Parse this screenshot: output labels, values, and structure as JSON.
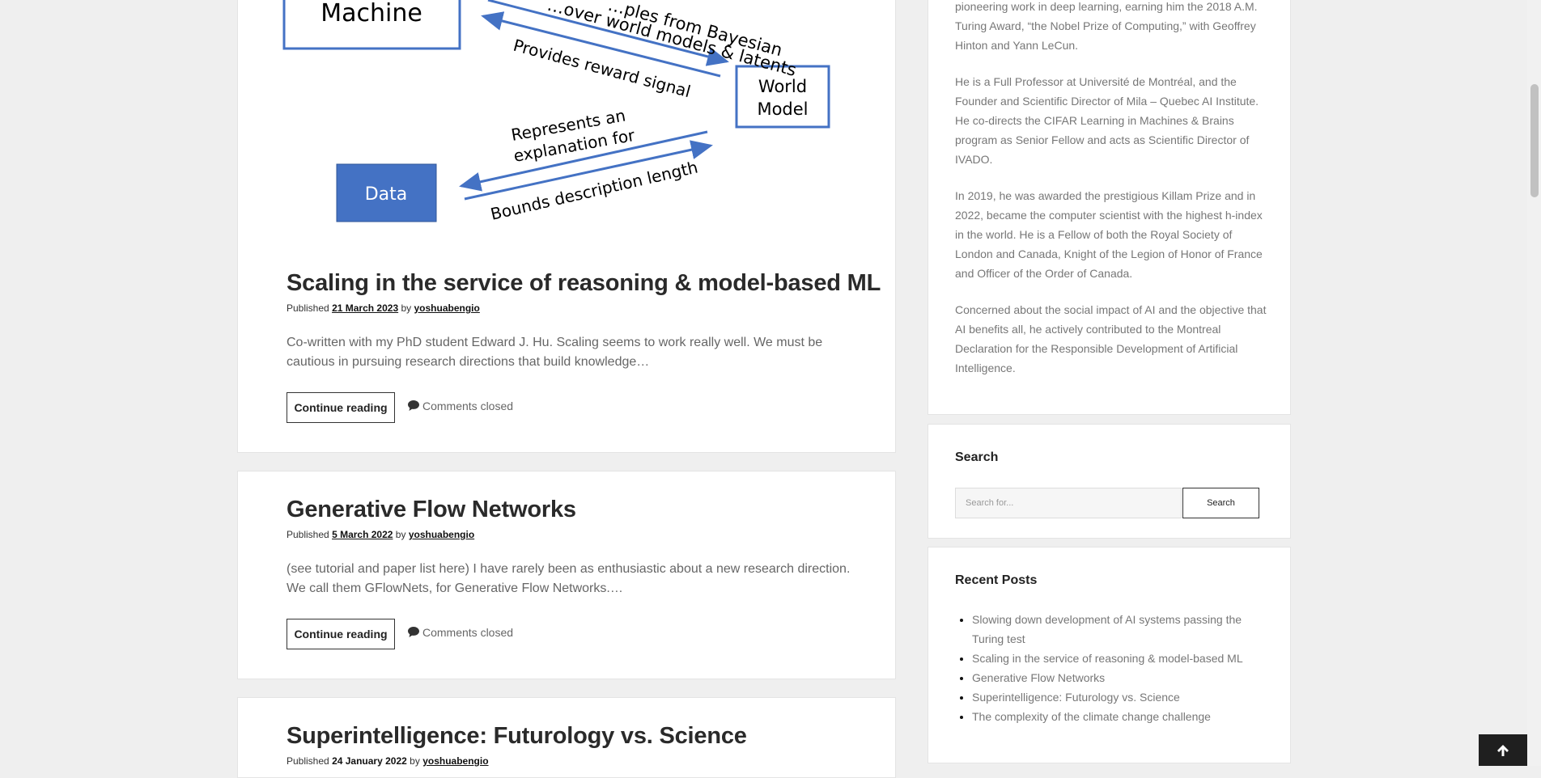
{
  "diagram": {
    "machine_label": "Machine",
    "world_model_line1": "World",
    "world_model_line2": "Model",
    "data_label": "Data",
    "arrow_top_line1": "…ples from Bayesian",
    "arrow_top_line2": "…over world models & latents",
    "arrow_reward": "Provides reward signal",
    "arrow_explain_line1": "Represents an",
    "arrow_explain_line2": "explanation for",
    "arrow_bounds": "Bounds description length"
  },
  "posts": [
    {
      "title": "Scaling in the service of reasoning & model-based ML",
      "published_prefix": "Published",
      "date": "21 March 2023",
      "by": "by",
      "author": "yoshuabengio",
      "excerpt": "Co-written with my PhD student Edward J. Hu. Scaling seems to work really well. We must be cautious in pursuing research directions that build knowledge…",
      "button": "Continue reading",
      "comments": "Comments closed"
    },
    {
      "title": "Generative Flow Networks",
      "published_prefix": "Published",
      "date": "5 March 2022",
      "by": "by",
      "author": "yoshuabengio",
      "excerpt": "(see tutorial and paper list here) I have rarely been as enthusiastic about a new research direction. We call them GFlowNets, for Generative Flow Networks.…",
      "button": "Continue reading",
      "comments": "Comments closed"
    },
    {
      "title": "Superintelligence: Futurology vs. Science",
      "published_prefix": "Published",
      "date": "24 January 2022",
      "by": "by",
      "author": "yoshuabengio"
    }
  ],
  "sidebar": {
    "bio": [
      "pioneering work in deep learning, earning him the 2018 A.M. Turing Award, “the Nobel Prize of Computing,” with Geoffrey Hinton and Yann LeCun.",
      "He is a Full Professor at Université de Montréal, and the Founder and Scientific Director of Mila – Quebec AI Institute. He co-directs the CIFAR Learning in Machines & Brains program as Senior Fellow and acts as Scientific Director of IVADO.",
      "In 2019, he was awarded the prestigious Killam Prize and in 2022, became the computer scientist with the highest h-index in the world. He is a Fellow of both the Royal Society of London and Canada, Knight of the Legion of Honor of France and Officer of the Order of Canada.",
      "Concerned about the social impact of AI and the objective that AI benefits all, he actively contributed to the Montreal Declaration for the Responsible Development of Artificial Intelligence."
    ],
    "search": {
      "title": "Search",
      "placeholder": "Search for...",
      "button": "Search"
    },
    "recent": {
      "title": "Recent Posts",
      "items": [
        "Slowing down development of AI systems passing the Turing test",
        "Scaling in the service of reasoning & model-based ML",
        "Generative Flow Networks",
        "Superintelligence: Futurology vs. Science",
        "The complexity of the climate change challenge"
      ]
    }
  },
  "colors": {
    "diagram_blue": "#4472c4",
    "background": "#efefef",
    "back_to_top": "#1f1f1f"
  },
  "icons": {
    "comment": "comment-icon",
    "back_to_top": "arrow-up-icon"
  }
}
